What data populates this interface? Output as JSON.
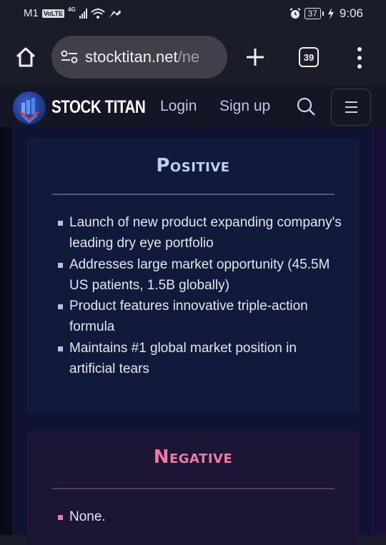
{
  "status_bar": {
    "carrier": "M1",
    "volte": "VoLTE",
    "network": "4G",
    "battery": "37",
    "time": "9:06"
  },
  "browser": {
    "url_host": "stocktitan.net",
    "url_path": "/ne",
    "tab_count": "39"
  },
  "site_header": {
    "brand": "STOCK TITAN",
    "login": "Login",
    "signup": "Sign up"
  },
  "positive": {
    "title": "Positive",
    "points": [
      "Launch of new product expanding company's leading dry eye portfolio",
      "Addresses large market opportunity (45.5M US patients, 1.5B globally)",
      "Product features innovative triple-action formula",
      "Maintains #1 global market position in artificial tears"
    ],
    "color": "#b8d3f0"
  },
  "negative": {
    "title": "Negative",
    "points": [
      "None."
    ],
    "color": "#f07aa0"
  }
}
